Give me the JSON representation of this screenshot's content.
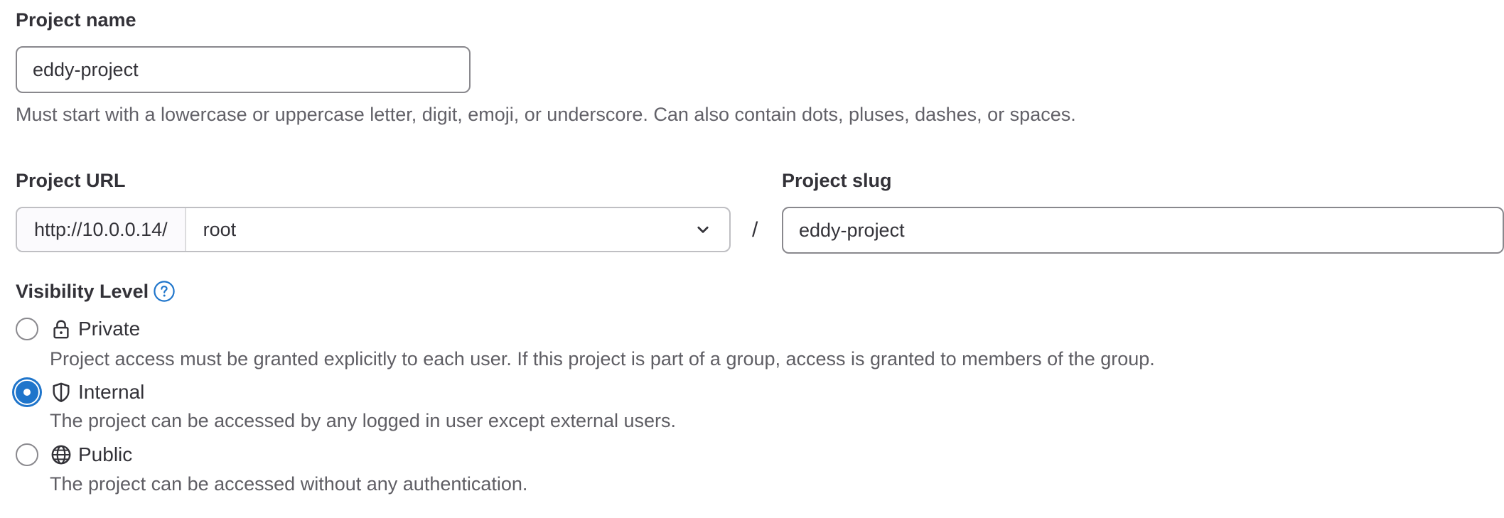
{
  "project_name": {
    "label": "Project name",
    "value": "eddy-project",
    "help": "Must start with a lowercase or uppercase letter, digit, emoji, or underscore. Can also contain dots, pluses, dashes, or spaces."
  },
  "project_url": {
    "label": "Project URL",
    "prefix": "http://10.0.0.14/",
    "namespace": "root",
    "separator": "/"
  },
  "project_slug": {
    "label": "Project slug",
    "value": "eddy-project"
  },
  "visibility": {
    "label": "Visibility Level",
    "help_icon": "question-circle-icon",
    "options": [
      {
        "label": "Private",
        "icon": "lock-icon",
        "description": "Project access must be granted explicitly to each user. If this project is part of a group, access is granted to members of the group.",
        "selected": false
      },
      {
        "label": "Internal",
        "icon": "shield-icon",
        "description": "The project can be accessed by any logged in user except external users.",
        "selected": true
      },
      {
        "label": "Public",
        "icon": "earth-icon",
        "description": "The project can be accessed without any authentication.",
        "selected": false
      }
    ]
  },
  "colors": {
    "accent": "#1f75cb",
    "text": "#333238",
    "muted": "#626168",
    "border": "#89888d"
  }
}
